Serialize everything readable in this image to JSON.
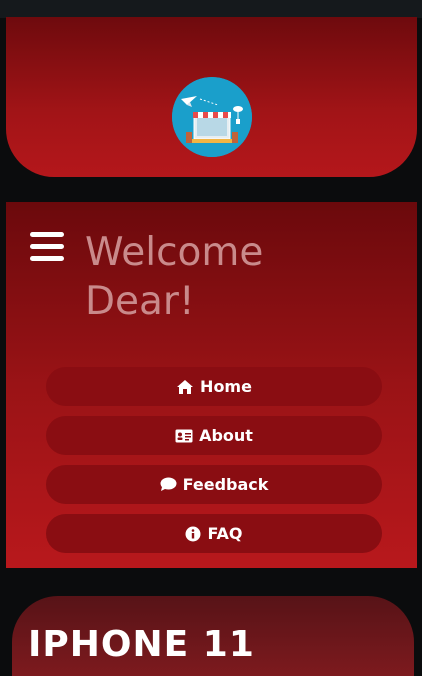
{
  "header": {
    "logo_icon": "online-store-logo"
  },
  "welcome": {
    "line1": "Welcome",
    "line2": "Dear!"
  },
  "menu": {
    "toggle_icon": "hamburger-menu-icon",
    "items": [
      {
        "label": "Home",
        "icon": "home-icon"
      },
      {
        "label": "About",
        "icon": "id-card-icon"
      },
      {
        "label": "Feedback",
        "icon": "comment-icon"
      },
      {
        "label": "FAQ",
        "icon": "info-circle-icon"
      }
    ]
  },
  "card": {
    "title": "IPHONE 11"
  },
  "colors": {
    "header_red": "#b4171b",
    "button_bg": "#8a0d12",
    "welcome_text": "#c98a8b",
    "logo_bg": "#1a9fcb",
    "page_bg": "#0b0c0d"
  }
}
